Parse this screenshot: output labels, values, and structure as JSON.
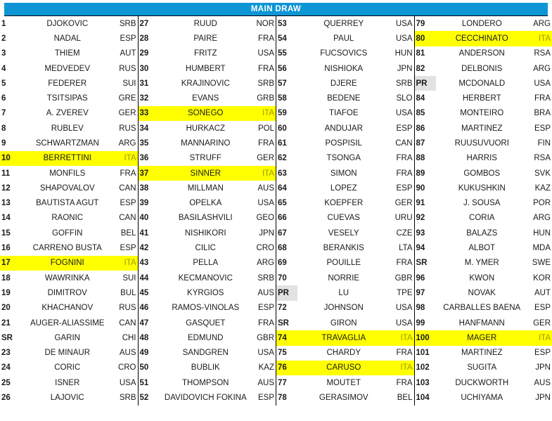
{
  "header": {
    "title": "MAIN DRAW",
    "bg_color": "#0D95D6",
    "text_color": "#FFFFFF"
  },
  "styles": {
    "highlight_color": "#FFFF00",
    "protected_ranking_bg": "#E2E2E2",
    "country_color": "#A6A6A6"
  },
  "columns": [
    {
      "rows": [
        {
          "seed": "1",
          "name": "DJOKOVIC",
          "country": "SRB",
          "highlight": false,
          "seed_box": false
        },
        {
          "seed": "2",
          "name": "NADAL",
          "country": "ESP",
          "highlight": false,
          "seed_box": false
        },
        {
          "seed": "3",
          "name": "THIEM",
          "country": "AUT",
          "highlight": false,
          "seed_box": false
        },
        {
          "seed": "4",
          "name": "MEDVEDEV",
          "country": "RUS",
          "highlight": false,
          "seed_box": false
        },
        {
          "seed": "5",
          "name": "FEDERER",
          "country": "SUI",
          "highlight": false,
          "seed_box": false
        },
        {
          "seed": "6",
          "name": "TSITSIPAS",
          "country": "GRE",
          "highlight": false,
          "seed_box": false
        },
        {
          "seed": "7",
          "name": "A. ZVEREV",
          "country": "GER",
          "highlight": false,
          "seed_box": false
        },
        {
          "seed": "8",
          "name": "RUBLEV",
          "country": "RUS",
          "highlight": false,
          "seed_box": false
        },
        {
          "seed": "9",
          "name": "SCHWARTZMAN",
          "country": "ARG",
          "highlight": false,
          "seed_box": false
        },
        {
          "seed": "10",
          "name": "BERRETTINI",
          "country": "ITA",
          "highlight": true,
          "seed_box": false
        },
        {
          "seed": "11",
          "name": "MONFILS",
          "country": "FRA",
          "highlight": false,
          "seed_box": false
        },
        {
          "seed": "12",
          "name": "SHAPOVALOV",
          "country": "CAN",
          "highlight": false,
          "seed_box": false
        },
        {
          "seed": "13",
          "name": "BAUTISTA AGUT",
          "country": "ESP",
          "highlight": false,
          "seed_box": false
        },
        {
          "seed": "14",
          "name": "RAONIC",
          "country": "CAN",
          "highlight": false,
          "seed_box": false
        },
        {
          "seed": "15",
          "name": "GOFFIN",
          "country": "BEL",
          "highlight": false,
          "seed_box": false
        },
        {
          "seed": "16",
          "name": "CARRENO BUSTA",
          "country": "ESP",
          "highlight": false,
          "seed_box": false
        },
        {
          "seed": "17",
          "name": "FOGNINI",
          "country": "ITA",
          "highlight": true,
          "seed_box": false
        },
        {
          "seed": "18",
          "name": "WAWRINKA",
          "country": "SUI",
          "highlight": false,
          "seed_box": false
        },
        {
          "seed": "19",
          "name": "DIMITROV",
          "country": "BUL",
          "highlight": false,
          "seed_box": false
        },
        {
          "seed": "20",
          "name": "KHACHANOV",
          "country": "RUS",
          "highlight": false,
          "seed_box": false
        },
        {
          "seed": "21",
          "name": "AUGER-ALIASSIME",
          "country": "CAN",
          "highlight": false,
          "seed_box": false
        },
        {
          "seed": "SR",
          "name": "GARIN",
          "country": "CHI",
          "highlight": false,
          "seed_box": false
        },
        {
          "seed": "23",
          "name": "DE MINAUR",
          "country": "AUS",
          "highlight": false,
          "seed_box": false
        },
        {
          "seed": "24",
          "name": "CORIC",
          "country": "CRO",
          "highlight": false,
          "seed_box": false
        },
        {
          "seed": "25",
          "name": "ISNER",
          "country": "USA",
          "highlight": false,
          "seed_box": false
        },
        {
          "seed": "26",
          "name": "LAJOVIC",
          "country": "SRB",
          "highlight": false,
          "seed_box": false
        }
      ]
    },
    {
      "rows": [
        {
          "seed": "27",
          "name": "RUUD",
          "country": "NOR",
          "highlight": false,
          "seed_box": false
        },
        {
          "seed": "28",
          "name": "PAIRE",
          "country": "FRA",
          "highlight": false,
          "seed_box": false
        },
        {
          "seed": "29",
          "name": "FRITZ",
          "country": "USA",
          "highlight": false,
          "seed_box": false
        },
        {
          "seed": "30",
          "name": "HUMBERT",
          "country": "FRA",
          "highlight": false,
          "seed_box": false
        },
        {
          "seed": "31",
          "name": "KRAJINOVIC",
          "country": "SRB",
          "highlight": false,
          "seed_box": false
        },
        {
          "seed": "32",
          "name": "EVANS",
          "country": "GRB",
          "highlight": false,
          "seed_box": false
        },
        {
          "seed": "33",
          "name": "SONEGO",
          "country": "ITA",
          "highlight": true,
          "seed_box": false
        },
        {
          "seed": "34",
          "name": "HURKACZ",
          "country": "POL",
          "highlight": false,
          "seed_box": false
        },
        {
          "seed": "35",
          "name": "MANNARINO",
          "country": "FRA",
          "highlight": false,
          "seed_box": false
        },
        {
          "seed": "36",
          "name": "STRUFF",
          "country": "GER",
          "highlight": false,
          "seed_box": false
        },
        {
          "seed": "37",
          "name": "SINNER",
          "country": "ITA",
          "highlight": true,
          "seed_box": false
        },
        {
          "seed": "38",
          "name": "MILLMAN",
          "country": "AUS",
          "highlight": false,
          "seed_box": false
        },
        {
          "seed": "39",
          "name": "OPELKA",
          "country": "USA",
          "highlight": false,
          "seed_box": false
        },
        {
          "seed": "40",
          "name": "BASILASHVILI",
          "country": "GEO",
          "highlight": false,
          "seed_box": false
        },
        {
          "seed": "41",
          "name": "NISHIKORI",
          "country": "JPN",
          "highlight": false,
          "seed_box": false
        },
        {
          "seed": "42",
          "name": "CILIC",
          "country": "CRO",
          "highlight": false,
          "seed_box": false
        },
        {
          "seed": "43",
          "name": "PELLA",
          "country": "ARG",
          "highlight": false,
          "seed_box": false
        },
        {
          "seed": "44",
          "name": "KECMANOVIC",
          "country": "SRB",
          "highlight": false,
          "seed_box": false
        },
        {
          "seed": "45",
          "name": "KYRGIOS",
          "country": "AUS",
          "highlight": false,
          "seed_box": false
        },
        {
          "seed": "46",
          "name": "RAMOS-VINOLAS",
          "country": "ESP",
          "highlight": false,
          "seed_box": false
        },
        {
          "seed": "47",
          "name": "GASQUET",
          "country": "FRA",
          "highlight": false,
          "seed_box": false
        },
        {
          "seed": "48",
          "name": "EDMUND",
          "country": "GBR",
          "highlight": false,
          "seed_box": false
        },
        {
          "seed": "49",
          "name": "SANDGREN",
          "country": "USA",
          "highlight": false,
          "seed_box": false
        },
        {
          "seed": "50",
          "name": "BUBLIK",
          "country": "KAZ",
          "highlight": false,
          "seed_box": false
        },
        {
          "seed": "51",
          "name": "THOMPSON",
          "country": "AUS",
          "highlight": false,
          "seed_box": false
        },
        {
          "seed": "52",
          "name": "DAVIDOVICH FOKINA",
          "country": "ESP",
          "highlight": false,
          "seed_box": false
        }
      ]
    },
    {
      "rows": [
        {
          "seed": "53",
          "name": "QUERREY",
          "country": "USA",
          "highlight": false,
          "seed_box": false
        },
        {
          "seed": "54",
          "name": "PAUL",
          "country": "USA",
          "highlight": false,
          "seed_box": false
        },
        {
          "seed": "55",
          "name": "FUCSOVICS",
          "country": "HUN",
          "highlight": false,
          "seed_box": false,
          "country_wrap": true
        },
        {
          "seed": "56",
          "name": "NISHIOKA",
          "country": "JPN",
          "highlight": false,
          "seed_box": false
        },
        {
          "seed": "57",
          "name": "DJERE",
          "country": "SRB",
          "highlight": false,
          "seed_box": false
        },
        {
          "seed": "58",
          "name": "BEDENE",
          "country": "SLO",
          "highlight": false,
          "seed_box": false
        },
        {
          "seed": "59",
          "name": "TIAFOE",
          "country": "USA",
          "highlight": false,
          "seed_box": false
        },
        {
          "seed": "60",
          "name": "ANDUJAR",
          "country": "ESP",
          "highlight": false,
          "seed_box": false
        },
        {
          "seed": "61",
          "name": "POSPISIL",
          "country": "CAN",
          "highlight": false,
          "seed_box": false
        },
        {
          "seed": "62",
          "name": "TSONGA",
          "country": "FRA",
          "highlight": false,
          "seed_box": false
        },
        {
          "seed": "63",
          "name": "SIMON",
          "country": "FRA",
          "highlight": false,
          "seed_box": false
        },
        {
          "seed": "64",
          "name": "LOPEZ",
          "country": "ESP",
          "highlight": false,
          "seed_box": false
        },
        {
          "seed": "65",
          "name": "KOEPFER",
          "country": "GER",
          "highlight": false,
          "seed_box": false
        },
        {
          "seed": "66",
          "name": "CUEVAS",
          "country": "URU",
          "highlight": false,
          "seed_box": false
        },
        {
          "seed": "67",
          "name": "VESELY",
          "country": "CZE",
          "highlight": false,
          "seed_box": false
        },
        {
          "seed": "68",
          "name": "BERANKIS",
          "country": "LTA",
          "highlight": false,
          "seed_box": false
        },
        {
          "seed": "69",
          "name": "POUILLE",
          "country": "FRA",
          "highlight": false,
          "seed_box": false
        },
        {
          "seed": "70",
          "name": "NORRIE",
          "country": "GBR",
          "highlight": false,
          "seed_box": false
        },
        {
          "seed": "PR",
          "name": "LU",
          "country": "TPE",
          "highlight": false,
          "seed_box": true
        },
        {
          "seed": "72",
          "name": "JOHNSON",
          "country": "USA",
          "highlight": false,
          "seed_box": false
        },
        {
          "seed": "SR",
          "name": "GIRON",
          "country": "USA",
          "highlight": false,
          "seed_box": false
        },
        {
          "seed": "74",
          "name": "TRAVAGLIA",
          "country": "ITA",
          "highlight": true,
          "seed_box": false
        },
        {
          "seed": "75",
          "name": "CHARDY",
          "country": "FRA",
          "highlight": false,
          "seed_box": false
        },
        {
          "seed": "76",
          "name": "CARUSO",
          "country": "ITA",
          "highlight": true,
          "seed_box": false
        },
        {
          "seed": "77",
          "name": "MOUTET",
          "country": "FRA",
          "highlight": false,
          "seed_box": false
        },
        {
          "seed": "78",
          "name": "GERASIMOV",
          "country": "BEL",
          "highlight": false,
          "seed_box": false
        }
      ]
    },
    {
      "rows": [
        {
          "seed": "79",
          "name": "LONDERO",
          "country": "ARG",
          "highlight": false,
          "seed_box": false
        },
        {
          "seed": "80",
          "name": "CECCHINATO",
          "country": "ITA",
          "highlight": true,
          "seed_box": false
        },
        {
          "seed": "81",
          "name": "ANDERSON",
          "country": "RSA",
          "highlight": false,
          "seed_box": false
        },
        {
          "seed": "82",
          "name": "DELBONIS",
          "country": "ARG",
          "highlight": false,
          "seed_box": false
        },
        {
          "seed": "PR",
          "name": "MCDONALD",
          "country": "USA",
          "highlight": false,
          "seed_box": true
        },
        {
          "seed": "84",
          "name": "HERBERT",
          "country": "FRA",
          "highlight": false,
          "seed_box": false
        },
        {
          "seed": "85",
          "name": "MONTEIRO",
          "country": "BRA",
          "highlight": false,
          "seed_box": false
        },
        {
          "seed": "86",
          "name": "MARTINEZ",
          "country": "ESP",
          "highlight": false,
          "seed_box": false
        },
        {
          "seed": "87",
          "name": "RUUSUVUORI",
          "country": "FIN",
          "highlight": false,
          "seed_box": false
        },
        {
          "seed": "88",
          "name": "HARRIS",
          "country": "RSA",
          "highlight": false,
          "seed_box": false
        },
        {
          "seed": "89",
          "name": "GOMBOS",
          "country": "SVK",
          "highlight": false,
          "seed_box": false
        },
        {
          "seed": "90",
          "name": "KUKUSHKIN",
          "country": "KAZ",
          "highlight": false,
          "seed_box": false
        },
        {
          "seed": "91",
          "name": "J. SOUSA",
          "country": "POR",
          "highlight": false,
          "seed_box": false
        },
        {
          "seed": "92",
          "name": "CORIA",
          "country": "ARG",
          "highlight": false,
          "seed_box": false
        },
        {
          "seed": "93",
          "name": "BALAZS",
          "country": "HUN",
          "highlight": false,
          "seed_box": false
        },
        {
          "seed": "94",
          "name": "ALBOT",
          "country": "MDA",
          "highlight": false,
          "seed_box": false,
          "country_wrap": true
        },
        {
          "seed": "SR",
          "name": "M. YMER",
          "country": "SWE",
          "highlight": false,
          "seed_box": false
        },
        {
          "seed": "96",
          "name": "KWON",
          "country": "KOR",
          "highlight": false,
          "seed_box": false
        },
        {
          "seed": "97",
          "name": "NOVAK",
          "country": "AUT",
          "highlight": false,
          "seed_box": false
        },
        {
          "seed": "98",
          "name": "CARBALLES BAENA",
          "country": "ESP",
          "highlight": false,
          "seed_box": false
        },
        {
          "seed": "99",
          "name": "HANFMANN",
          "country": "GER",
          "highlight": false,
          "seed_box": false
        },
        {
          "seed": "100",
          "name": "MAGER",
          "country": "ITA",
          "highlight": true,
          "seed_box": false
        },
        {
          "seed": "101",
          "name": "MARTINEZ",
          "country": "ESP",
          "highlight": false,
          "seed_box": false
        },
        {
          "seed": "102",
          "name": "SUGITA",
          "country": "JPN",
          "highlight": false,
          "seed_box": false
        },
        {
          "seed": "103",
          "name": "DUCKWORTH",
          "country": "AUS",
          "highlight": false,
          "seed_box": false
        },
        {
          "seed": "104",
          "name": "UCHIYAMA",
          "country": "JPN",
          "highlight": false,
          "seed_box": false
        }
      ]
    }
  ]
}
